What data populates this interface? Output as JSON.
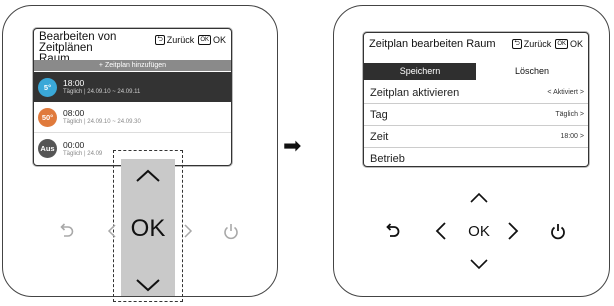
{
  "left": {
    "title_line1": "Bearbeiten von Zeitplänen",
    "title_line2": "Raum",
    "back_label": "Zurück",
    "ok_label": "OK",
    "ok_icon_text": "OK",
    "add_label": "+ Zeitplan hinzufügen",
    "items": [
      {
        "badge": "5°",
        "time": "18:00",
        "sub": "Täglich | 24.09.10 ~ 24.09.11",
        "badge_color": "#3aa8d8",
        "selected": true
      },
      {
        "badge": "50°",
        "time": "08:00",
        "sub": "Täglich | 24.09.10 ~ 24.09.30",
        "badge_color": "#e07a3c",
        "selected": false
      },
      {
        "badge": "Aus",
        "time": "00:00",
        "sub": "Täglich | 24.09",
        "badge_color": "#555555",
        "selected": false
      }
    ],
    "ok_button": "OK"
  },
  "arrow_symbol": "➡",
  "right": {
    "title": "Zeitplan bearbeiten Raum",
    "back_label": "Zurück",
    "ok_label": "OK",
    "ok_icon_text": "OK",
    "tab_save": "Speichern",
    "tab_delete": "Löschen",
    "rows": [
      {
        "label": "Zeitplan aktivieren",
        "value": "< Aktiviert >"
      },
      {
        "label": "Tag",
        "value": "Täglich >"
      },
      {
        "label": "Zeit",
        "value": "18:00 >"
      },
      {
        "label": "Betrieb",
        "value": ""
      }
    ],
    "ok_button": "OK"
  },
  "colors": {
    "selected_row": "#333333",
    "add_bar": "#8a8a8a",
    "highlight_box": "#c9c9c9",
    "icon_gray": "#a8a8a8"
  }
}
